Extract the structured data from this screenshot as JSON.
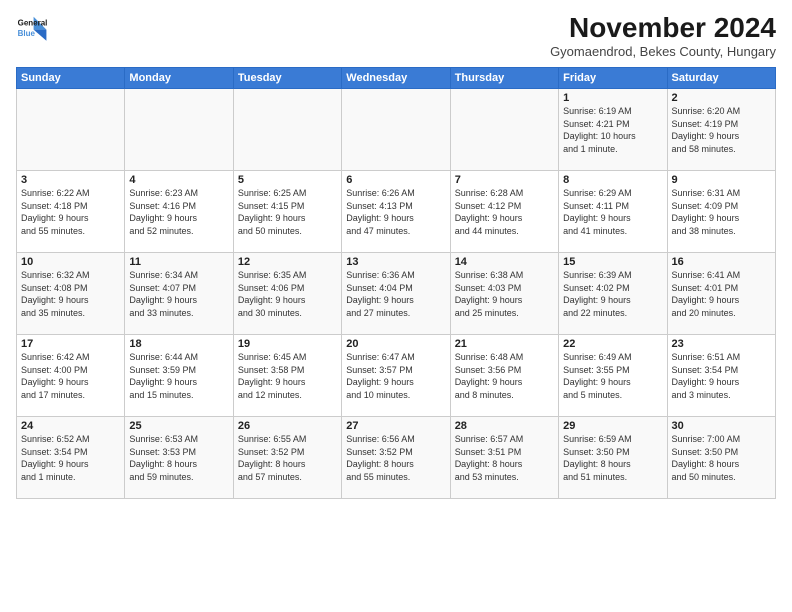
{
  "logo": {
    "line1": "General",
    "line2": "Blue"
  },
  "title": "November 2024",
  "subtitle": "Gyomaendrod, Bekes County, Hungary",
  "days_of_week": [
    "Sunday",
    "Monday",
    "Tuesday",
    "Wednesday",
    "Thursday",
    "Friday",
    "Saturday"
  ],
  "weeks": [
    [
      {
        "day": "",
        "info": ""
      },
      {
        "day": "",
        "info": ""
      },
      {
        "day": "",
        "info": ""
      },
      {
        "day": "",
        "info": ""
      },
      {
        "day": "",
        "info": ""
      },
      {
        "day": "1",
        "info": "Sunrise: 6:19 AM\nSunset: 4:21 PM\nDaylight: 10 hours\nand 1 minute."
      },
      {
        "day": "2",
        "info": "Sunrise: 6:20 AM\nSunset: 4:19 PM\nDaylight: 9 hours\nand 58 minutes."
      }
    ],
    [
      {
        "day": "3",
        "info": "Sunrise: 6:22 AM\nSunset: 4:18 PM\nDaylight: 9 hours\nand 55 minutes."
      },
      {
        "day": "4",
        "info": "Sunrise: 6:23 AM\nSunset: 4:16 PM\nDaylight: 9 hours\nand 52 minutes."
      },
      {
        "day": "5",
        "info": "Sunrise: 6:25 AM\nSunset: 4:15 PM\nDaylight: 9 hours\nand 50 minutes."
      },
      {
        "day": "6",
        "info": "Sunrise: 6:26 AM\nSunset: 4:13 PM\nDaylight: 9 hours\nand 47 minutes."
      },
      {
        "day": "7",
        "info": "Sunrise: 6:28 AM\nSunset: 4:12 PM\nDaylight: 9 hours\nand 44 minutes."
      },
      {
        "day": "8",
        "info": "Sunrise: 6:29 AM\nSunset: 4:11 PM\nDaylight: 9 hours\nand 41 minutes."
      },
      {
        "day": "9",
        "info": "Sunrise: 6:31 AM\nSunset: 4:09 PM\nDaylight: 9 hours\nand 38 minutes."
      }
    ],
    [
      {
        "day": "10",
        "info": "Sunrise: 6:32 AM\nSunset: 4:08 PM\nDaylight: 9 hours\nand 35 minutes."
      },
      {
        "day": "11",
        "info": "Sunrise: 6:34 AM\nSunset: 4:07 PM\nDaylight: 9 hours\nand 33 minutes."
      },
      {
        "day": "12",
        "info": "Sunrise: 6:35 AM\nSunset: 4:06 PM\nDaylight: 9 hours\nand 30 minutes."
      },
      {
        "day": "13",
        "info": "Sunrise: 6:36 AM\nSunset: 4:04 PM\nDaylight: 9 hours\nand 27 minutes."
      },
      {
        "day": "14",
        "info": "Sunrise: 6:38 AM\nSunset: 4:03 PM\nDaylight: 9 hours\nand 25 minutes."
      },
      {
        "day": "15",
        "info": "Sunrise: 6:39 AM\nSunset: 4:02 PM\nDaylight: 9 hours\nand 22 minutes."
      },
      {
        "day": "16",
        "info": "Sunrise: 6:41 AM\nSunset: 4:01 PM\nDaylight: 9 hours\nand 20 minutes."
      }
    ],
    [
      {
        "day": "17",
        "info": "Sunrise: 6:42 AM\nSunset: 4:00 PM\nDaylight: 9 hours\nand 17 minutes."
      },
      {
        "day": "18",
        "info": "Sunrise: 6:44 AM\nSunset: 3:59 PM\nDaylight: 9 hours\nand 15 minutes."
      },
      {
        "day": "19",
        "info": "Sunrise: 6:45 AM\nSunset: 3:58 PM\nDaylight: 9 hours\nand 12 minutes."
      },
      {
        "day": "20",
        "info": "Sunrise: 6:47 AM\nSunset: 3:57 PM\nDaylight: 9 hours\nand 10 minutes."
      },
      {
        "day": "21",
        "info": "Sunrise: 6:48 AM\nSunset: 3:56 PM\nDaylight: 9 hours\nand 8 minutes."
      },
      {
        "day": "22",
        "info": "Sunrise: 6:49 AM\nSunset: 3:55 PM\nDaylight: 9 hours\nand 5 minutes."
      },
      {
        "day": "23",
        "info": "Sunrise: 6:51 AM\nSunset: 3:54 PM\nDaylight: 9 hours\nand 3 minutes."
      }
    ],
    [
      {
        "day": "24",
        "info": "Sunrise: 6:52 AM\nSunset: 3:54 PM\nDaylight: 9 hours\nand 1 minute."
      },
      {
        "day": "25",
        "info": "Sunrise: 6:53 AM\nSunset: 3:53 PM\nDaylight: 8 hours\nand 59 minutes."
      },
      {
        "day": "26",
        "info": "Sunrise: 6:55 AM\nSunset: 3:52 PM\nDaylight: 8 hours\nand 57 minutes."
      },
      {
        "day": "27",
        "info": "Sunrise: 6:56 AM\nSunset: 3:52 PM\nDaylight: 8 hours\nand 55 minutes."
      },
      {
        "day": "28",
        "info": "Sunrise: 6:57 AM\nSunset: 3:51 PM\nDaylight: 8 hours\nand 53 minutes."
      },
      {
        "day": "29",
        "info": "Sunrise: 6:59 AM\nSunset: 3:50 PM\nDaylight: 8 hours\nand 51 minutes."
      },
      {
        "day": "30",
        "info": "Sunrise: 7:00 AM\nSunset: 3:50 PM\nDaylight: 8 hours\nand 50 minutes."
      }
    ]
  ]
}
